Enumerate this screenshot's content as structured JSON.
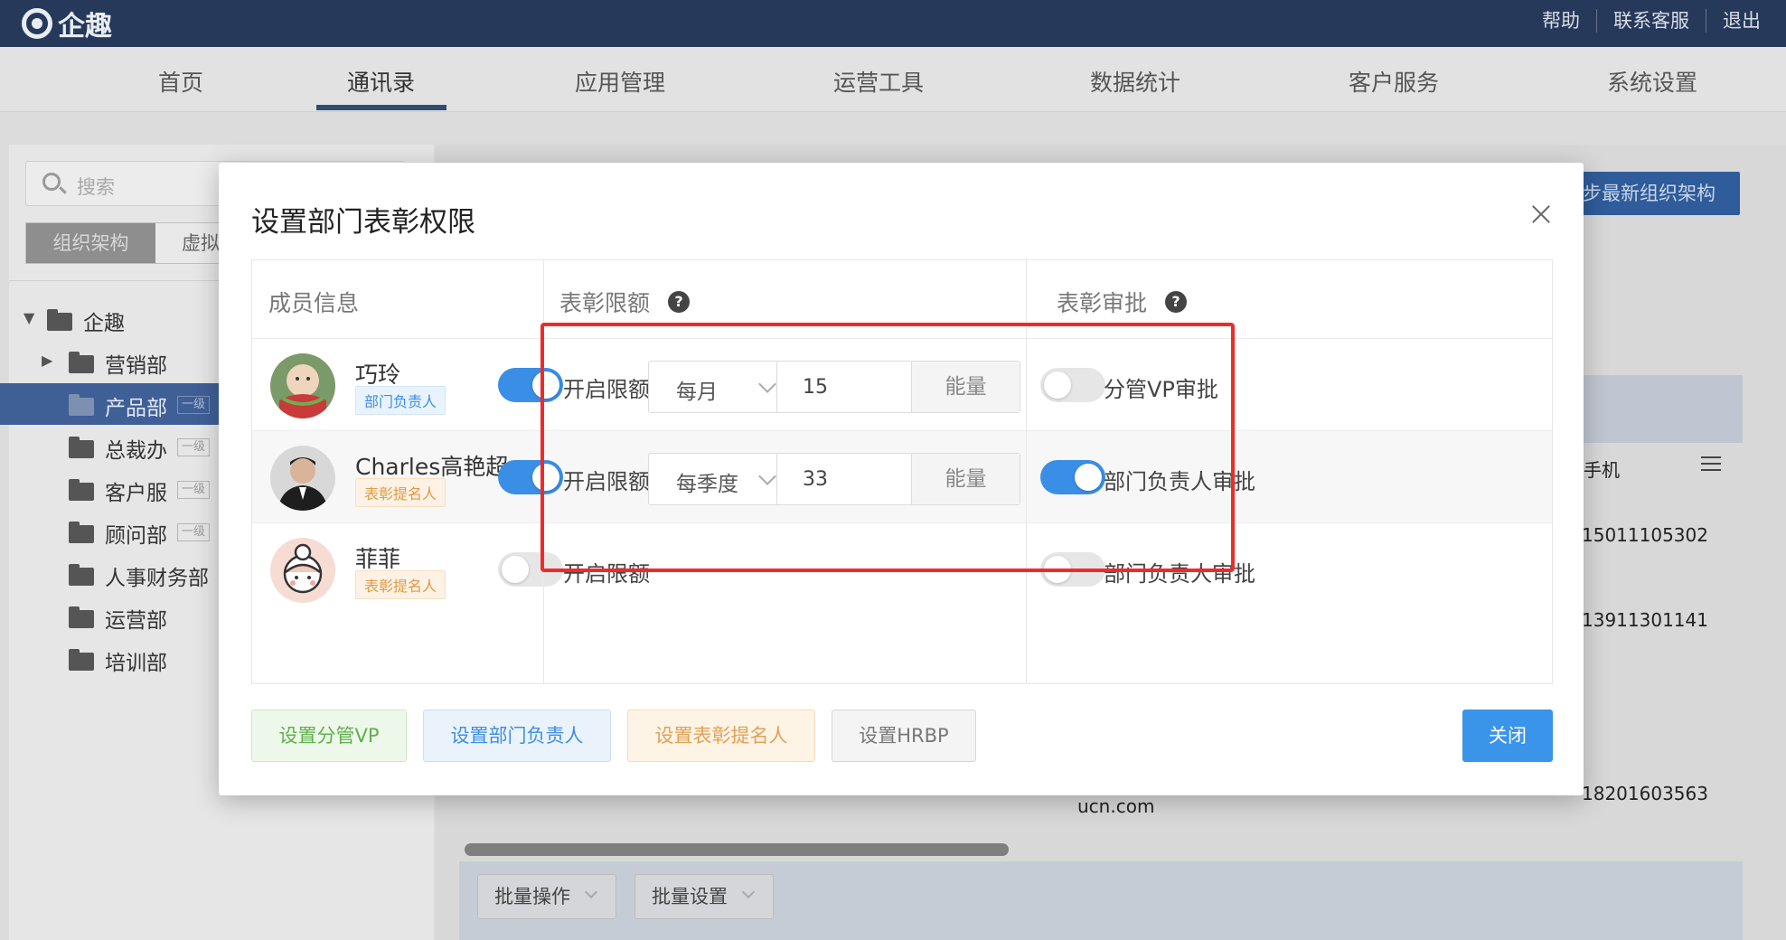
{
  "app": {
    "logo_text": "企趣"
  },
  "top_links": [
    "帮助",
    "联系客服",
    "退出"
  ],
  "nav": {
    "items": [
      "首页",
      "通讯录",
      "应用管理",
      "运营工具",
      "数据统计",
      "客户服务",
      "系统设置"
    ],
    "active_index": 1
  },
  "sidebar": {
    "search_placeholder": "搜索",
    "tabs": [
      "组织架构",
      "虚拟"
    ],
    "root": "企趣",
    "items": [
      {
        "label": "营销部",
        "tag": ""
      },
      {
        "label": "产品部",
        "tag": "一级"
      },
      {
        "label": "总裁办",
        "tag": "一级"
      },
      {
        "label": "客户服",
        "tag": "一级"
      },
      {
        "label": "顾问部",
        "tag": "一级"
      },
      {
        "label": "人事财务部",
        "tag": ""
      },
      {
        "label": "运营部",
        "tag": ""
      },
      {
        "label": "培训部",
        "tag": ""
      }
    ]
  },
  "background": {
    "sync_button": "步最新组织架构",
    "phone_col": "手机",
    "phones": [
      "15011105302",
      "13911301141",
      "18201603563"
    ],
    "email_fragment": "ucn.com",
    "batch_ops": "批量操作",
    "batch_settings": "批量设置"
  },
  "dialog": {
    "title": "设置部门表彰权限",
    "headers": {
      "member": "成员信息",
      "limit": "表彰限额",
      "approval": "表彰审批"
    },
    "rows": [
      {
        "name": "巧玲",
        "tag": "部门负责人",
        "tag_color": "blue",
        "limit_on": true,
        "limit_label": "开启限额",
        "period": "每月",
        "amount": "15",
        "unit": "能量",
        "approval_on": false,
        "approval_label": "分管VP审批"
      },
      {
        "name": "Charles高艳超",
        "tag": "表彰提名人",
        "tag_color": "orange",
        "limit_on": true,
        "limit_label": "开启限额",
        "period": "每季度",
        "amount": "33",
        "unit": "能量",
        "approval_on": true,
        "approval_label": "部门负责人审批"
      },
      {
        "name": "菲菲",
        "tag": "表彰提名人",
        "tag_color": "orange",
        "limit_on": false,
        "limit_label": "开启限额",
        "approval_on": false,
        "approval_label": "部门负责人审批"
      }
    ],
    "buttons": {
      "vp": "设置分管VP",
      "dept_head": "设置部门负责人",
      "nominator": "设置表彰提名人",
      "hrbp": "设置HRBP",
      "close": "关闭"
    },
    "accent": "#3a8ee6",
    "highlight_color": "#f02a2a"
  }
}
